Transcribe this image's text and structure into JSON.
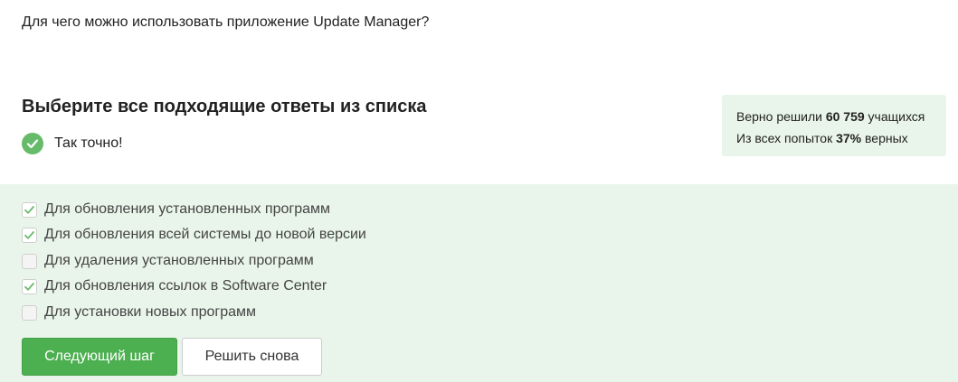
{
  "question": "Для чего можно использовать приложение Update Manager?",
  "heading": "Выберите все подходящие ответы из списка",
  "result_label": "Так точно!",
  "stats": {
    "line1_prefix": "Верно решили ",
    "solved_count": "60 759",
    "line1_suffix": " учащихся",
    "line2_prefix": "Из всех попыток ",
    "percent": "37%",
    "line2_suffix": " верных"
  },
  "options": [
    {
      "label": "Для обновления установленных программ",
      "checked": true
    },
    {
      "label": "Для обновления всей системы до новой версии",
      "checked": true
    },
    {
      "label": "Для удаления установленных программ",
      "checked": false
    },
    {
      "label": "Для обновления ссылок в Software Center",
      "checked": true
    },
    {
      "label": "Для установки новых программ",
      "checked": false
    }
  ],
  "buttons": {
    "next": "Следующий шаг",
    "retry": "Решить снова"
  },
  "colors": {
    "accent": "#4caf50",
    "panel": "#e9f5ea",
    "check": "#66bb6a"
  }
}
